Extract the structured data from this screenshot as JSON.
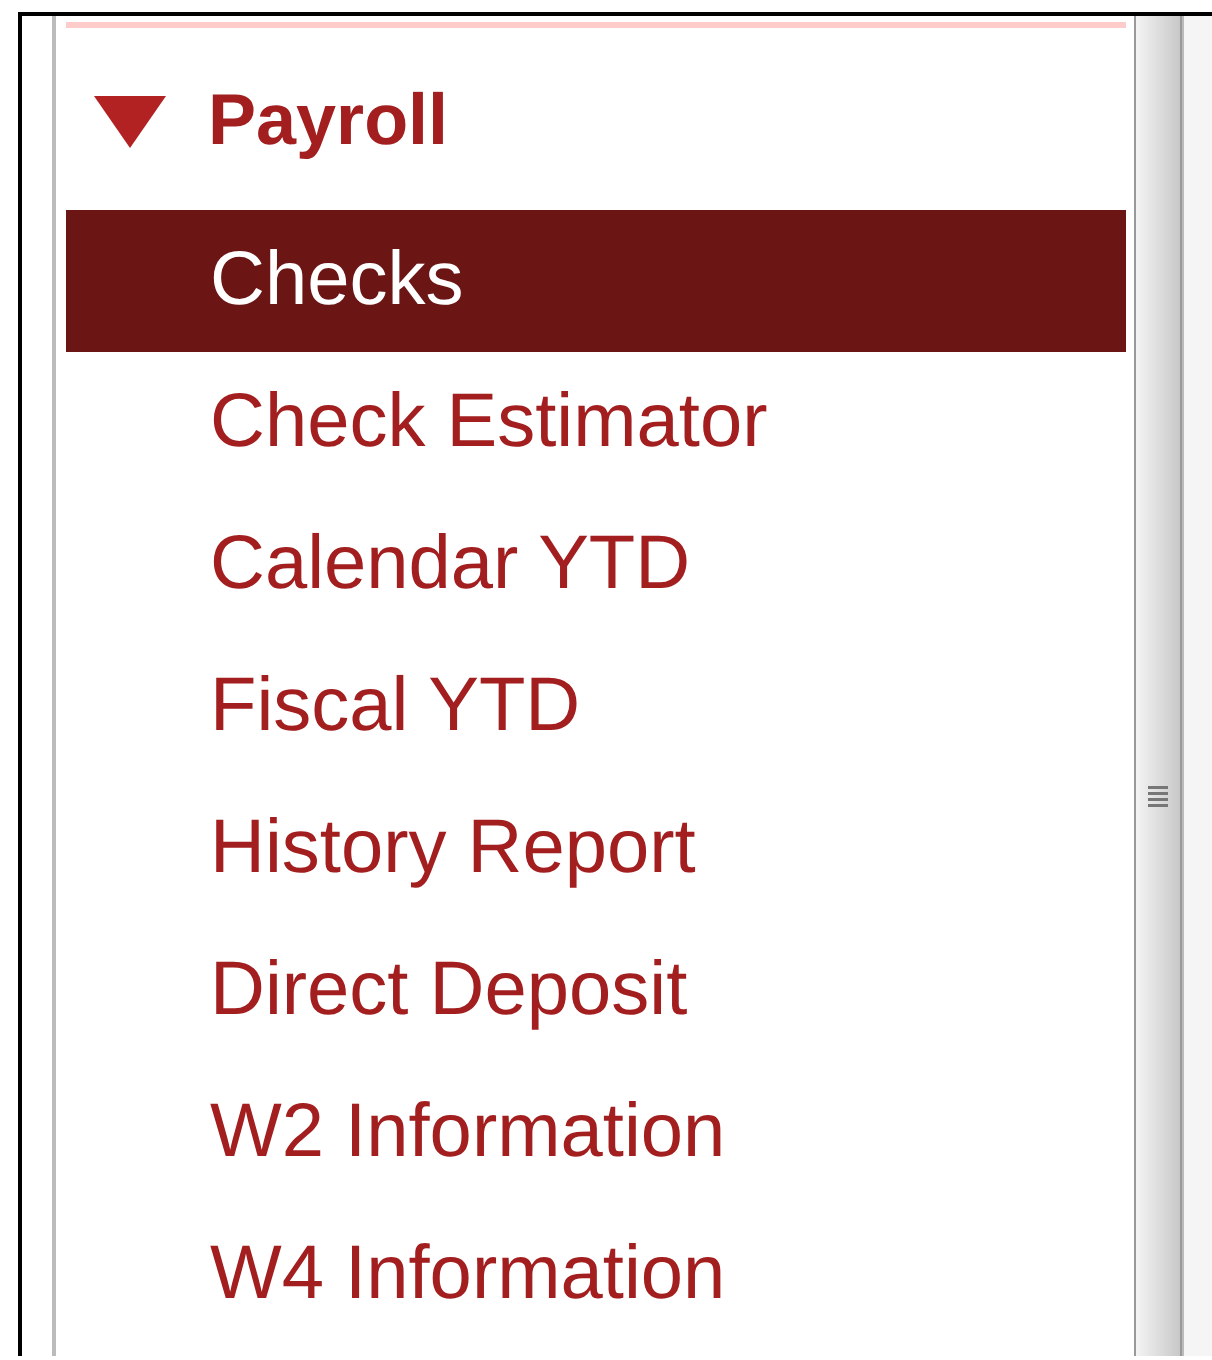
{
  "menu": {
    "title": "Payroll",
    "expanded": true,
    "items": [
      {
        "label": "Checks",
        "selected": true
      },
      {
        "label": "Check Estimator",
        "selected": false
      },
      {
        "label": "Calendar YTD",
        "selected": false
      },
      {
        "label": "Fiscal YTD",
        "selected": false
      },
      {
        "label": "History Report",
        "selected": false
      },
      {
        "label": "Direct Deposit",
        "selected": false
      },
      {
        "label": "W2 Information",
        "selected": false
      },
      {
        "label": "W4 Information",
        "selected": false
      }
    ]
  }
}
